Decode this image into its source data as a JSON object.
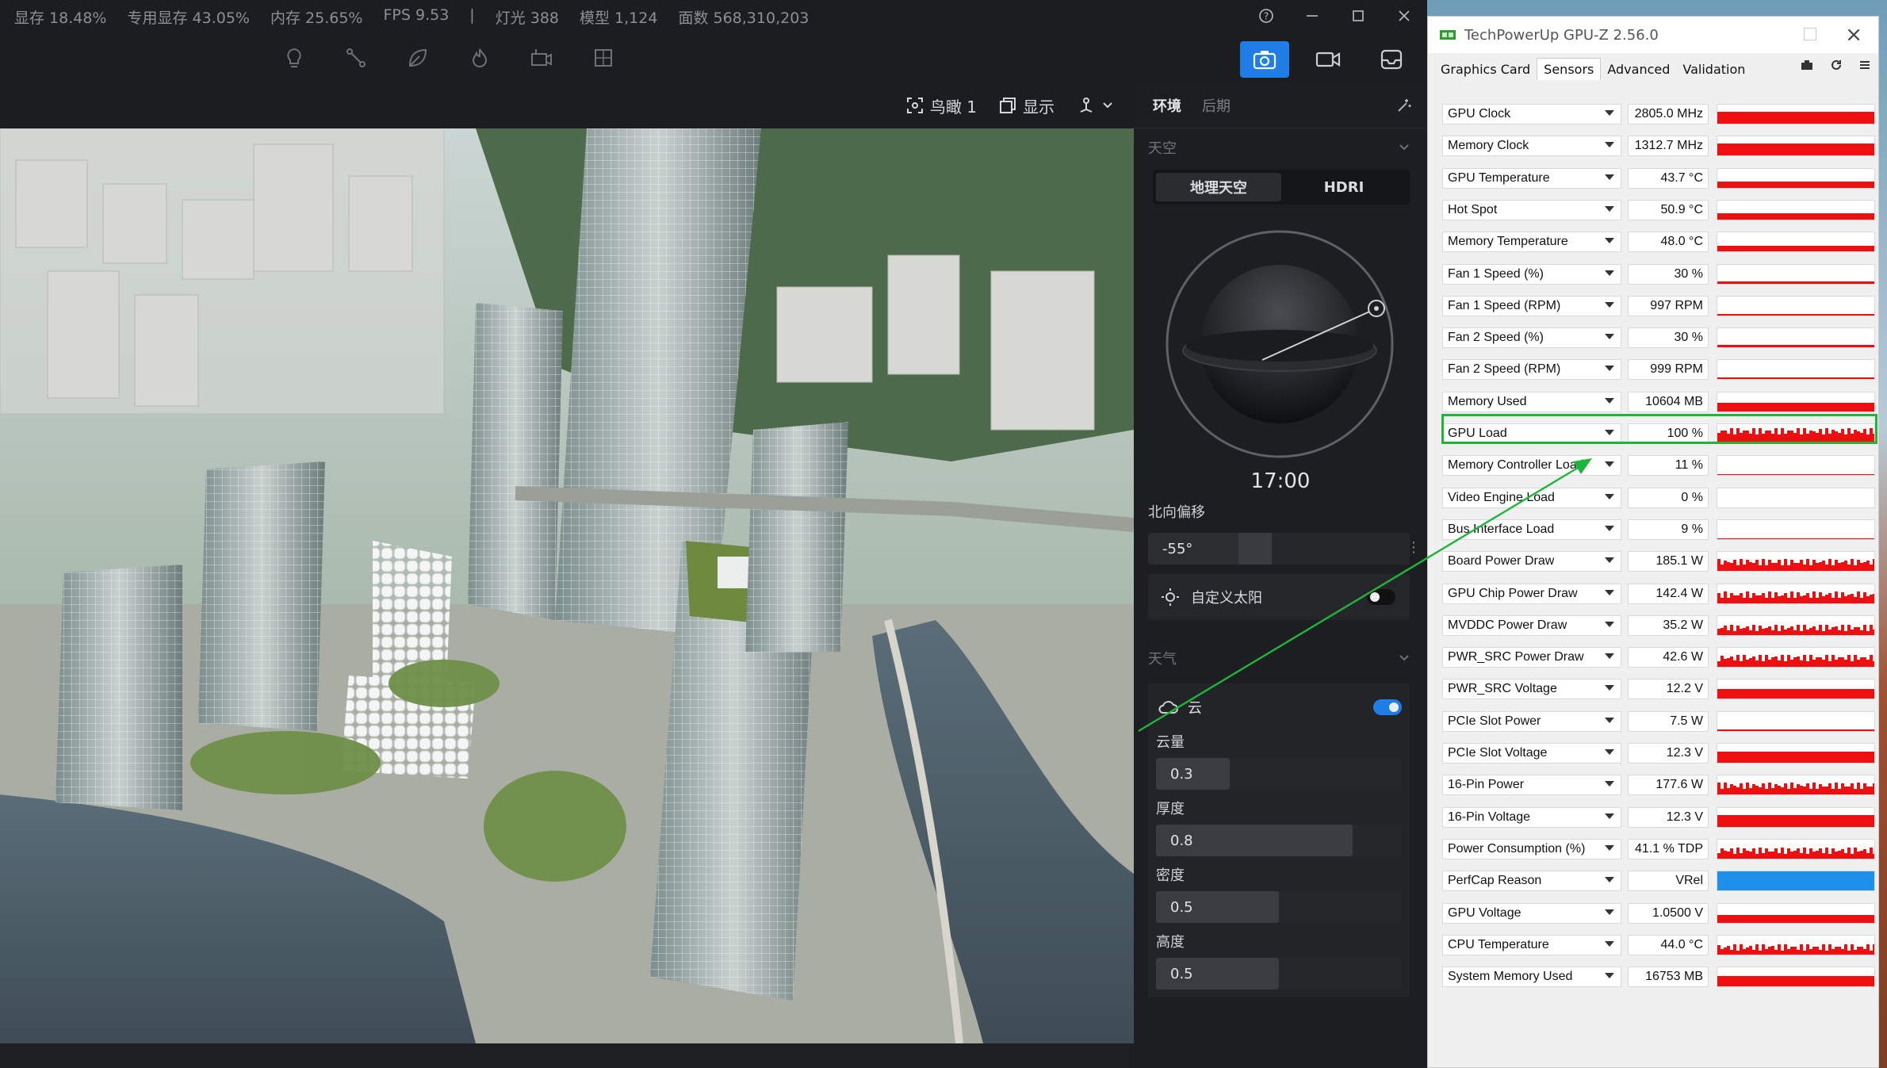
{
  "stats": [
    "显存 18.48%",
    "专用显存 43.05%",
    "内存 25.65%",
    "FPS 9.53",
    "|",
    "灯光 388",
    "模型 1,124",
    "面数 568,310,203"
  ],
  "tools": [
    "bulb-icon",
    "path-icon",
    "leaf-icon",
    "fire-icon",
    "camera-mount-icon",
    "grid-icon"
  ],
  "modes": [
    {
      "name": "photo-icon",
      "active": true
    },
    {
      "name": "video-icon",
      "active": false
    },
    {
      "name": "inbox-icon",
      "active": false
    }
  ],
  "viewport_toolbar": {
    "view_label": "鸟瞰 1",
    "display_label": "显示",
    "nav_icon": "navigate-icon"
  },
  "panel": {
    "tabs": [
      "环境",
      "后期"
    ],
    "sky_section": "天空",
    "sky_options": [
      "地理天空",
      "HDRI"
    ],
    "time": "17:00",
    "north_offset_label": "北向偏移",
    "north_offset_value": "-55°",
    "custom_sun_label": "自定义太阳",
    "custom_sun_on": false,
    "weather_section": "天气",
    "cloud_label": "云",
    "cloud_on": true,
    "sliders": [
      {
        "label": "云量",
        "value": "0.3",
        "fraction": 0.3
      },
      {
        "label": "厚度",
        "value": "0.8",
        "fraction": 0.8
      },
      {
        "label": "密度",
        "value": "0.5",
        "fraction": 0.5
      },
      {
        "label": "高度",
        "value": "0.5",
        "fraction": 0.5
      }
    ]
  },
  "gpuz": {
    "title": "TechPowerUp GPU-Z 2.56.0",
    "tabs": [
      "Graphics Card",
      "Sensors",
      "Advanced",
      "Validation"
    ],
    "active_tab": "Sensors",
    "sensors": [
      {
        "name": "GPU Clock",
        "value": "2805.0 MHz",
        "level": 0.62,
        "graph": "solid"
      },
      {
        "name": "Memory Clock",
        "value": "1312.7 MHz",
        "level": 0.62,
        "graph": "solid"
      },
      {
        "name": "GPU Temperature",
        "value": "43.7 °C",
        "level": 0.3,
        "graph": "solid"
      },
      {
        "name": "Hot Spot",
        "value": "50.9 °C",
        "level": 0.35,
        "graph": "solid"
      },
      {
        "name": "Memory Temperature",
        "value": "48.0 °C",
        "level": 0.32,
        "graph": "solid"
      },
      {
        "name": "Fan 1 Speed (%)",
        "value": "30 %",
        "level": 0.12,
        "graph": "solid"
      },
      {
        "name": "Fan 1 Speed (RPM)",
        "value": "997 RPM",
        "level": 0.08,
        "graph": "solid"
      },
      {
        "name": "Fan 2 Speed (%)",
        "value": "30 %",
        "level": 0.12,
        "graph": "solid"
      },
      {
        "name": "Fan 2 Speed (RPM)",
        "value": "999 RPM",
        "level": 0.08,
        "graph": "solid"
      },
      {
        "name": "Memory Used",
        "value": "10604 MB",
        "level": 0.45,
        "graph": "solid"
      },
      {
        "name": "GPU Load",
        "value": "100 %",
        "level": 0.55,
        "graph": "noisy"
      },
      {
        "name": "Memory Controller Load",
        "value": "11 %",
        "level": 0.06,
        "graph": "solid"
      },
      {
        "name": "Video Engine Load",
        "value": "0 %",
        "level": 0.0,
        "graph": "solid"
      },
      {
        "name": "Bus Interface Load",
        "value": "9 %",
        "level": 0.05,
        "graph": "solid"
      },
      {
        "name": "Board Power Draw",
        "value": "185.1 W",
        "level": 0.4,
        "graph": "noisy"
      },
      {
        "name": "GPU Chip Power Draw",
        "value": "142.4 W",
        "level": 0.35,
        "graph": "noisy"
      },
      {
        "name": "MVDDC Power Draw",
        "value": "35.2 W",
        "level": 0.3,
        "graph": "noisy"
      },
      {
        "name": "PWR_SRC Power Draw",
        "value": "42.6 W",
        "level": 0.4,
        "graph": "noisy"
      },
      {
        "name": "PWR_SRC Voltage",
        "value": "12.2 V",
        "level": 0.5,
        "graph": "solid"
      },
      {
        "name": "PCIe Slot Power",
        "value": "7.5 W",
        "level": 0.08,
        "graph": "solid"
      },
      {
        "name": "PCIe Slot Voltage",
        "value": "12.3 V",
        "level": 0.6,
        "graph": "solid"
      },
      {
        "name": "16-Pin Power",
        "value": "177.6 W",
        "level": 0.4,
        "graph": "noisy"
      },
      {
        "name": "16-Pin Voltage",
        "value": "12.3 V",
        "level": 0.6,
        "graph": "solid"
      },
      {
        "name": "Power Consumption (%)",
        "value": "41.1 % TDP",
        "level": 0.35,
        "graph": "noisy"
      },
      {
        "name": "PerfCap Reason",
        "value": "VRel",
        "level": 1.0,
        "graph": "blue"
      },
      {
        "name": "GPU Voltage",
        "value": "1.0500 V",
        "level": 0.4,
        "graph": "solid"
      },
      {
        "name": "CPU Temperature",
        "value": "44.0 °C",
        "level": 0.3,
        "graph": "noisy"
      },
      {
        "name": "System Memory Used",
        "value": "16753 MB",
        "level": 0.55,
        "graph": "solid"
      }
    ],
    "highlighted": "GPU Load"
  },
  "colors": {
    "accent": "#1e7de6",
    "graph_red": "#ee0f10",
    "graph_blue": "#1e90ea",
    "annotation_green": "#1fb43a"
  }
}
